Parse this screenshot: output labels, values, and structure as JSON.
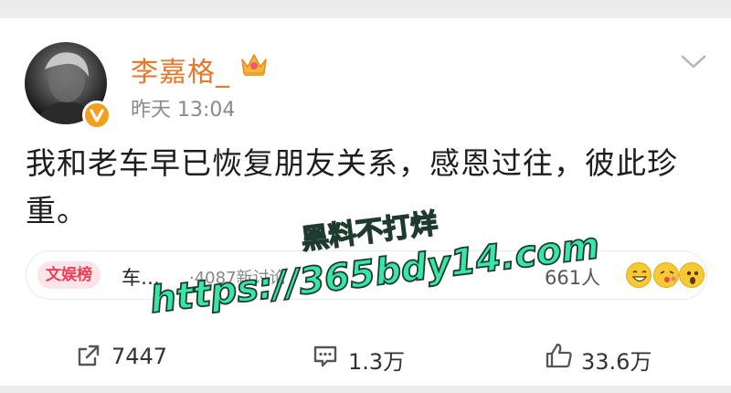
{
  "post": {
    "username": "李嘉格_",
    "time": "昨天 13:04",
    "text": "我和老车早已恢复朋友关系，感恩过往，彼此珍重。"
  },
  "topic": {
    "tag": "文娱榜",
    "title": "车…",
    "meta": "·4087新讨论",
    "participants": "661人"
  },
  "watermark": {
    "line1": "黑料不打烊",
    "line2": "https://365bdy14.com"
  },
  "actions": {
    "repost_count": "7447",
    "comment_count": "1.3万",
    "like_count": "33.6万"
  },
  "icons": {
    "crown": "crown-icon",
    "verified": "verified-badge-icon",
    "more": "chevron-down-icon",
    "repost": "repost-icon",
    "comment": "comment-icon",
    "like": "thumbs-up-icon"
  },
  "colors": {
    "username": "#e8772c",
    "tag_text": "#ef3d56",
    "tag_bg": "#fde4e8",
    "watermark": "#38e6a8",
    "verified": "#f19f1d"
  }
}
